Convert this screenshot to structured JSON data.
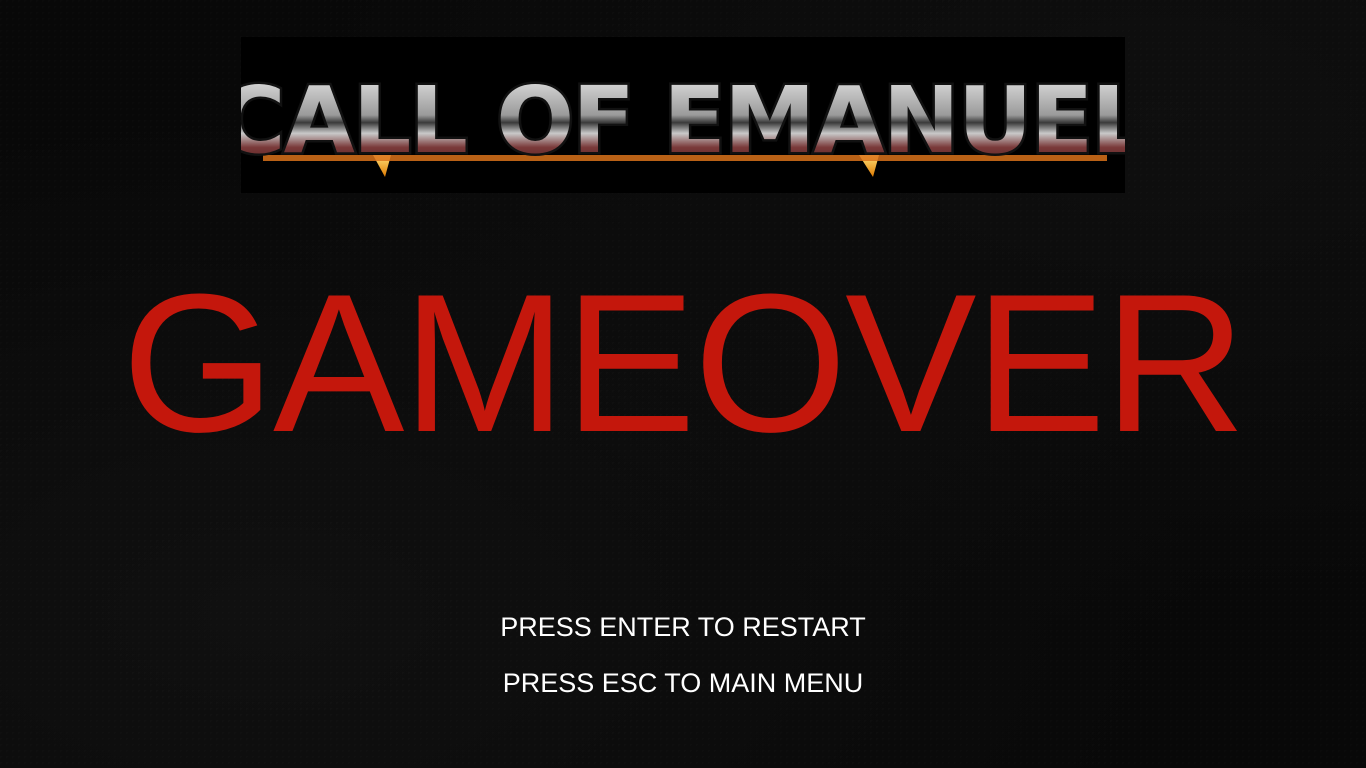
{
  "logo": {
    "text": "CALL OF EMANUEL",
    "fill_top": "#d9d9d9",
    "fill_bottom": "#6b2a2a",
    "outline": "#1a1a1a",
    "flame": "#f2a40c"
  },
  "status": {
    "title": "GAMEOVER",
    "title_color": "#c4170c"
  },
  "prompts": {
    "restart": "PRESS ENTER TO RESTART",
    "main_menu": "PRESS ESC TO MAIN MENU"
  }
}
